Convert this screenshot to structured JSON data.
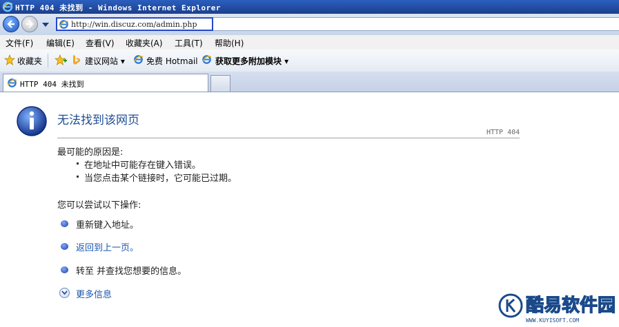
{
  "window": {
    "title": "HTTP 404 未找到 - Windows Internet Explorer"
  },
  "address": {
    "url": "http://win.discuz.com/admin.php"
  },
  "menubar": {
    "items": [
      "文件(F)",
      "编辑(E)",
      "查看(V)",
      "收藏夹(A)",
      "工具(T)",
      "帮助(H)"
    ]
  },
  "favorites": {
    "label": "收藏夹",
    "items": [
      "建议网站 ▾",
      "免费 Hotmail",
      "获取更多附加模块 ▾"
    ]
  },
  "tab": {
    "title": "HTTP 404 未找到"
  },
  "page": {
    "title": "无法找到该网页",
    "code": "HTTP 404",
    "reason_heading": "最可能的原因是:",
    "reasons": [
      "在地址中可能存在键入错误。",
      "当您点击某个链接时，它可能已过期。"
    ],
    "try_heading": "您可以尝试以下操作:",
    "actions": [
      "重新键入地址。",
      "返回到上一页。",
      "转至   并查找您想要的信息。"
    ],
    "more_info": "更多信息"
  },
  "watermark": {
    "text": "酷易软件园",
    "sub": "WWW.KUYISOFT.COM"
  },
  "colors": {
    "link": "#1a56b0",
    "title_blue": "#1f4e94",
    "titlebar": "#1c3f8a"
  }
}
